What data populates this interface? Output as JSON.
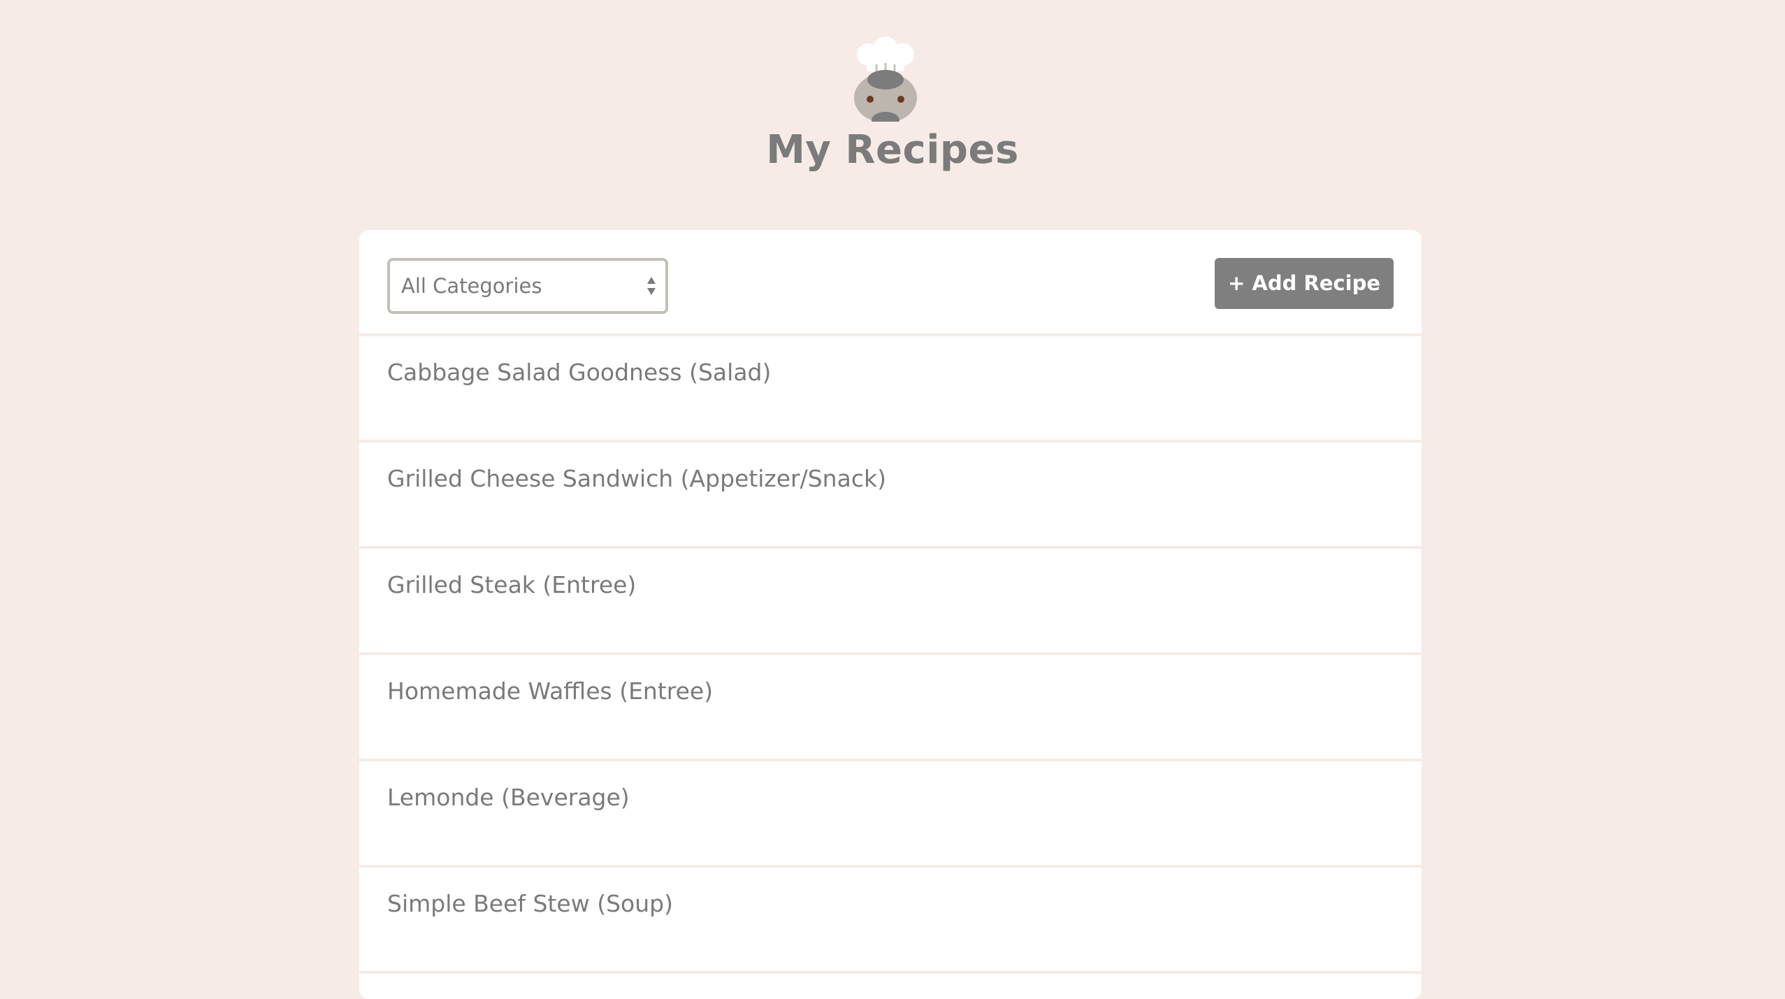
{
  "header": {
    "title": "My Recipes",
    "logo_icon": "chef-hat-face-icon"
  },
  "toolbar": {
    "category_select": {
      "selected": "All Categories",
      "icon": "select-arrows-icon"
    },
    "add_button_label": "+ Add Recipe"
  },
  "recipes": [
    {
      "title": "Cabbage Salad Goodness (Salad)"
    },
    {
      "title": "Grilled Cheese Sandwich (Appetizer/Snack)"
    },
    {
      "title": "Grilled Steak (Entree)"
    },
    {
      "title": "Homemade Waffles (Entree)"
    },
    {
      "title": "Lemonde (Beverage)"
    },
    {
      "title": "Simple Beef Stew (Soup)"
    }
  ],
  "colors": {
    "background": "#f6ebe6",
    "panel": "#ffffff",
    "button": "#7f7f7f",
    "text": "#7a7a7a"
  }
}
